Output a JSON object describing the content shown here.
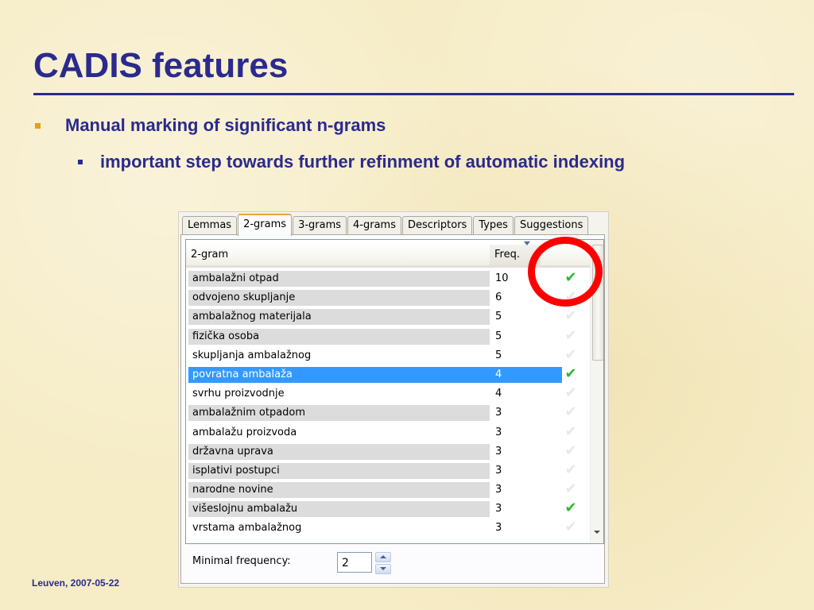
{
  "slide": {
    "title": "CADIS features",
    "bullet1": "Manual marking of significant n-grams",
    "bullet2": "important step towards further refinment of automatic indexing",
    "footer": "Leuven, 2007-05-22"
  },
  "dialog": {
    "tabs": [
      "Lemmas",
      "2-grams",
      "3-grams",
      "4-grams",
      "Descriptors",
      "Types",
      "Suggestions"
    ],
    "active_tab": "2-grams",
    "columns": {
      "ngram": "2-gram",
      "freq": "Freq."
    },
    "rows": [
      {
        "ngram": "ambalažni otpad",
        "freq": "10",
        "checked": true,
        "grey": true
      },
      {
        "ngram": "odvojeno skupljanje",
        "freq": "6",
        "checked": false,
        "grey": true
      },
      {
        "ngram": "ambalažnog materijala",
        "freq": "5",
        "checked": false,
        "grey": true
      },
      {
        "ngram": "fizička osoba",
        "freq": "5",
        "checked": false,
        "grey": true
      },
      {
        "ngram": "skupljanja ambalažnog",
        "freq": "5",
        "checked": false,
        "grey": false
      },
      {
        "ngram": "povratna ambalaža",
        "freq": "4",
        "checked": true,
        "grey": false,
        "selected": true
      },
      {
        "ngram": "svrhu proizvodnje",
        "freq": "4",
        "checked": false,
        "grey": false
      },
      {
        "ngram": "ambalažnim otpadom",
        "freq": "3",
        "checked": false,
        "grey": true
      },
      {
        "ngram": "ambalažu proizvoda",
        "freq": "3",
        "checked": false,
        "grey": false
      },
      {
        "ngram": "državna uprava",
        "freq": "3",
        "checked": false,
        "grey": true
      },
      {
        "ngram": "isplativi postupci",
        "freq": "3",
        "checked": false,
        "grey": true
      },
      {
        "ngram": "narodne novine",
        "freq": "3",
        "checked": false,
        "grey": true
      },
      {
        "ngram": "višeslojnu ambalažu",
        "freq": "3",
        "checked": true,
        "grey": true
      },
      {
        "ngram": "vrstama ambalažnog",
        "freq": "3",
        "checked": false,
        "grey": false
      }
    ],
    "min_freq_label": "Minimal frequency:",
    "min_freq_value": "2"
  }
}
